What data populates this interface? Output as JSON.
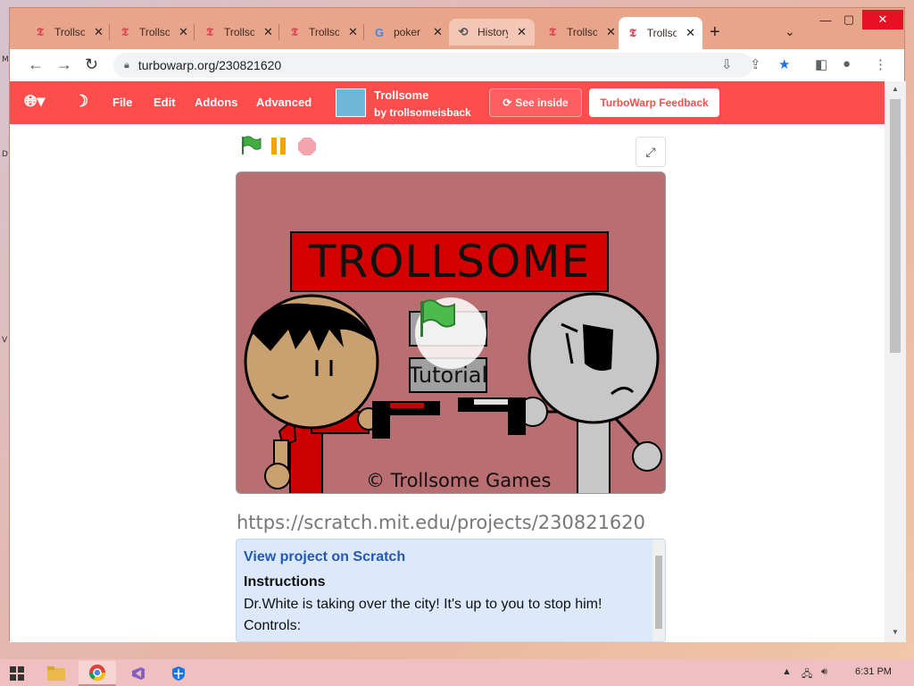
{
  "browser": {
    "tabs": [
      {
        "label": "Trollsome",
        "favicon": "turbowarp-icon",
        "active": false
      },
      {
        "label": "Trollsome",
        "favicon": "turbowarp-icon",
        "active": false
      },
      {
        "label": "Trollsome",
        "favicon": "turbowarp-icon",
        "active": false
      },
      {
        "label": "Trollsome",
        "favicon": "turbowarp-icon",
        "active": false
      },
      {
        "label": "poker",
        "favicon": "google-icon",
        "active": false
      },
      {
        "label": "History",
        "favicon": "history-icon",
        "active": false
      },
      {
        "label": "Trollsome",
        "favicon": "turbowarp-icon",
        "active": false
      },
      {
        "label": "Trollsome",
        "favicon": "turbowarp-icon",
        "active": true
      }
    ],
    "url": "turbowarp.org/230821620"
  },
  "menubar": {
    "items": [
      "File",
      "Edit",
      "Addons",
      "Advanced"
    ],
    "project_title": "Trollsome",
    "project_author": "by trollsomeisback",
    "see_inside": "See inside",
    "feedback": "TurboWarp Feedback"
  },
  "stage": {
    "game_title": "TROLLSOME",
    "tutorial_label": "Tutorial",
    "copyright": "© Trollsome Games"
  },
  "project_url": "https://scratch.mit.edu/projects/230821620",
  "description": {
    "link": "View project on Scratch",
    "heading": "Instructions",
    "lines": [
      "Dr.White is taking over the city! It's up to you to stop him!",
      "Controls:"
    ]
  },
  "taskbar": {
    "time": "6:31 PM"
  },
  "colors": {
    "turbowarp_red": "#ff4c4c",
    "stage_bg": "#b96f71",
    "description_bg": "#dbe9fb"
  }
}
